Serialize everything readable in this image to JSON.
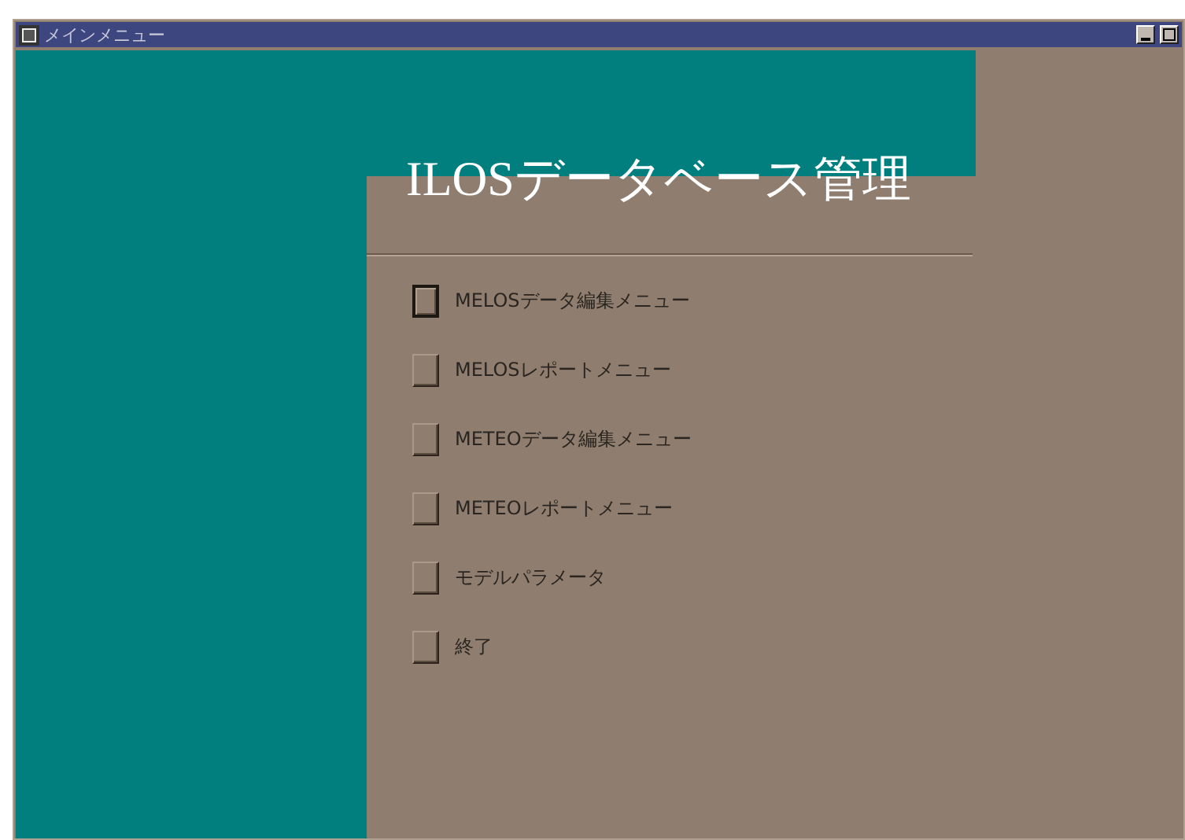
{
  "window": {
    "title": "メインメニュー"
  },
  "heading": "ILOSデータベース管理",
  "menu_items": [
    {
      "label": "MELOSデータ編集メニュー",
      "focused": true
    },
    {
      "label": "MELOSレポートメニュー",
      "focused": false
    },
    {
      "label": "METEOデータ編集メニュー",
      "focused": false
    },
    {
      "label": "METEOレポートメニュー",
      "focused": false
    },
    {
      "label": "モデルパラメータ",
      "focused": false
    },
    {
      "label": "終了",
      "focused": false
    }
  ]
}
